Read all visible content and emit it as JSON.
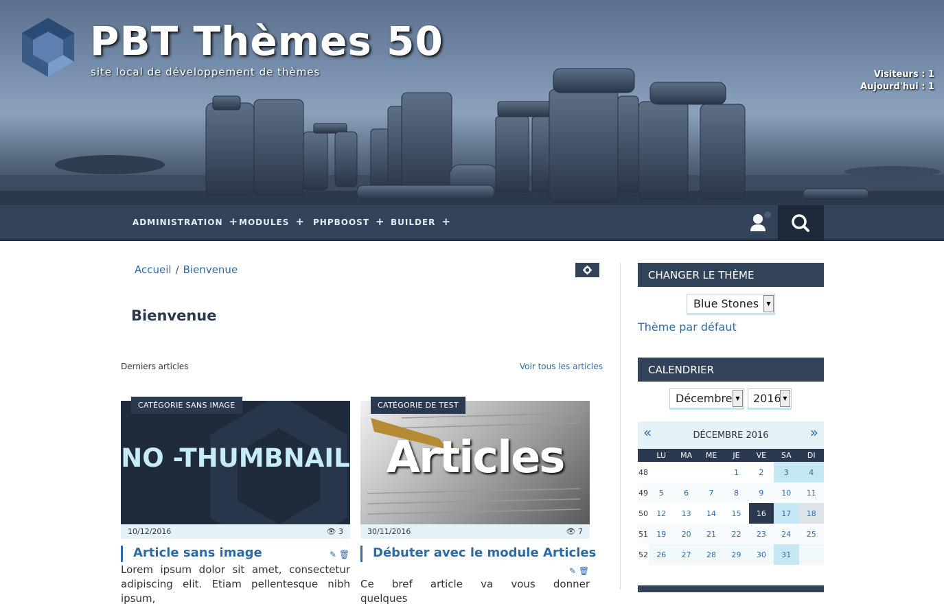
{
  "header": {
    "site_title": "PBT Thèmes 50",
    "site_subtitle": "site local de développement de thèmes",
    "visitors": "Visiteurs : 1",
    "today": "Aujourd'hui : 1",
    "colors": {
      "nav_bg": "#33435a",
      "link": "#2e6aa4",
      "dark": "#2b3950"
    }
  },
  "nav": {
    "items": [
      {
        "label": "ADMINISTRATION"
      },
      {
        "label": "MODULES"
      },
      {
        "label": "PHPBOOST"
      },
      {
        "label": "BUILDER"
      }
    ],
    "plus": "+",
    "user_icon": "user-icon",
    "search_icon": "search-icon"
  },
  "breadcrumb": {
    "home": "Accueil",
    "sep": "/",
    "current": "Bienvenue"
  },
  "main": {
    "title": "Bienvenue",
    "latest_label": "Derniers articles",
    "see_all": "Voir tous les articles",
    "articles": [
      {
        "category": "CATÉGORIE SANS IMAGE",
        "thumb_text": "NO -THUMBNAIL",
        "date": "10/12/2016",
        "views": "3",
        "title": "Article sans image",
        "text": "Lorem ipsum dolor sit amet, consectetur adipiscing elit. Etiam pellentesque nibh ipsum,"
      },
      {
        "category": "CATÉGORIE DE TEST",
        "thumb_text": "Articles",
        "date": "30/11/2016",
        "views": "7",
        "title": "Débuter avec le module Articles",
        "text": "Ce bref article va vous donner quelques"
      }
    ]
  },
  "sidebar": {
    "theme_header": "CHANGER LE THÈME",
    "theme_select": "Blue Stones",
    "theme_default": "Thème par défaut",
    "calendar_header": "CALENDRIER",
    "month_select": "Décembre",
    "year_select": "2016",
    "month_title": "DÉCEMBRE 2016",
    "prev": "«",
    "next": "»",
    "weekdays": [
      "LU",
      "MA",
      "ME",
      "JE",
      "VE",
      "SA",
      "DI"
    ],
    "weeks": [
      {
        "num": "48",
        "days": [
          "",
          "",
          "",
          "1",
          "2",
          "3",
          "4"
        ]
      },
      {
        "num": "49",
        "days": [
          "5",
          "6",
          "7",
          "8",
          "9",
          "10",
          "11"
        ]
      },
      {
        "num": "50",
        "days": [
          "12",
          "13",
          "14",
          "15",
          "16",
          "17",
          "18"
        ]
      },
      {
        "num": "51",
        "days": [
          "19",
          "20",
          "21",
          "22",
          "23",
          "24",
          "25"
        ]
      },
      {
        "num": "52",
        "days": [
          "26",
          "27",
          "28",
          "29",
          "30",
          "31",
          ""
        ]
      }
    ]
  }
}
